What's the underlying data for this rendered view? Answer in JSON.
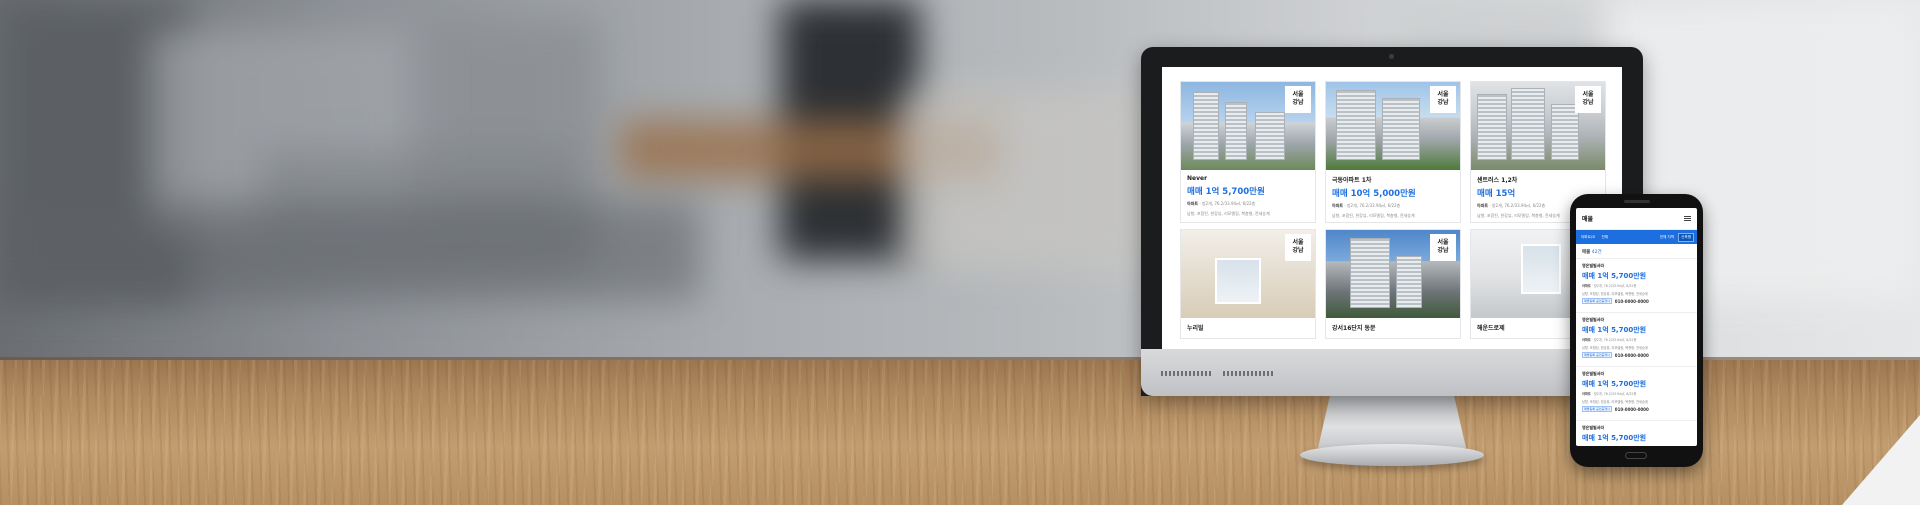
{
  "desktop": {
    "listings": [
      {
        "badge": "서울\n강남",
        "title": "Never",
        "price": "매매 1억 5,700만원",
        "type": "아파트",
        "meta1": "방2개, 76.2/33.94㎡, 6/22층",
        "meta2": "남향, 포함된, 한강뷰, 리모델링, 복층형, 전세승계"
      },
      {
        "badge": "서울\n강남",
        "title": "극동아파트 1차",
        "price": "매매 10억 5,000만원",
        "type": "아파트",
        "meta1": "방2개, 76.2/33.94㎡, 6/22층",
        "meta2": "남향, 포함된, 한강뷰, 리모델링, 복층형, 전세승계"
      },
      {
        "badge": "서울\n강남",
        "title": "센트러스 1,2차",
        "price": "매매 15억",
        "type": "아파트",
        "meta1": "방2개, 76.2/33.94㎡, 6/22층",
        "meta2": "남향, 포함된, 한강뷰, 리모델링, 복층형, 전세승계"
      },
      {
        "badge": "서울\n강남",
        "title": "누리빌",
        "price": "",
        "type": "",
        "meta1": "",
        "meta2": ""
      },
      {
        "badge": "서울\n강남",
        "title": "강서16단지 동문",
        "price": "",
        "type": "",
        "meta1": "",
        "meta2": ""
      },
      {
        "badge": "",
        "title": "해운드로제",
        "price": "",
        "type": "",
        "meta1": "",
        "meta2": ""
      }
    ]
  },
  "phone": {
    "header_title": "매물",
    "filters": [
      "아파트/오",
      "전체",
      "전체 지역",
      "신축형"
    ],
    "count_label": "매물",
    "count_value": "42건",
    "items": [
      {
        "name": "영은빌빌서라",
        "price": "매매 1억 5,700만원",
        "type": "아파트",
        "meta1": "방2개, 76.2/33.94㎡, 6/22층",
        "meta2": "남향, 포함된, 한강뷰, 리모델링, 복층형, 전세승계",
        "tag": "매물등록 공인중개사",
        "tel": "010-0000-0000"
      },
      {
        "name": "영은빌빌서라",
        "price": "매매 1억 5,700만원",
        "type": "아파트",
        "meta1": "방2개, 76.2/33.94㎡, 6/22층",
        "meta2": "남향, 포함된, 한강뷰, 리모델링, 복층형, 전세승계",
        "tag": "매물등록 공인중개사",
        "tel": "010-0000-0000"
      },
      {
        "name": "영은빌빌서라",
        "price": "매매 1억 5,700만원",
        "type": "아파트",
        "meta1": "방2개, 76.2/33.94㎡, 6/22층",
        "meta2": "남향, 포함된, 한강뷰, 리모델링, 복층형, 전세승계",
        "tag": "매물등록 공인중개사",
        "tel": "010-0000-0000"
      },
      {
        "name": "영은빌빌서라",
        "price": "매매 1억 5,700만원",
        "type": "",
        "meta1": "",
        "meta2": "",
        "tag": "",
        "tel": ""
      }
    ]
  },
  "colors": {
    "accent": "#1d6fe0",
    "filter_bar": "#1d6fe0"
  }
}
